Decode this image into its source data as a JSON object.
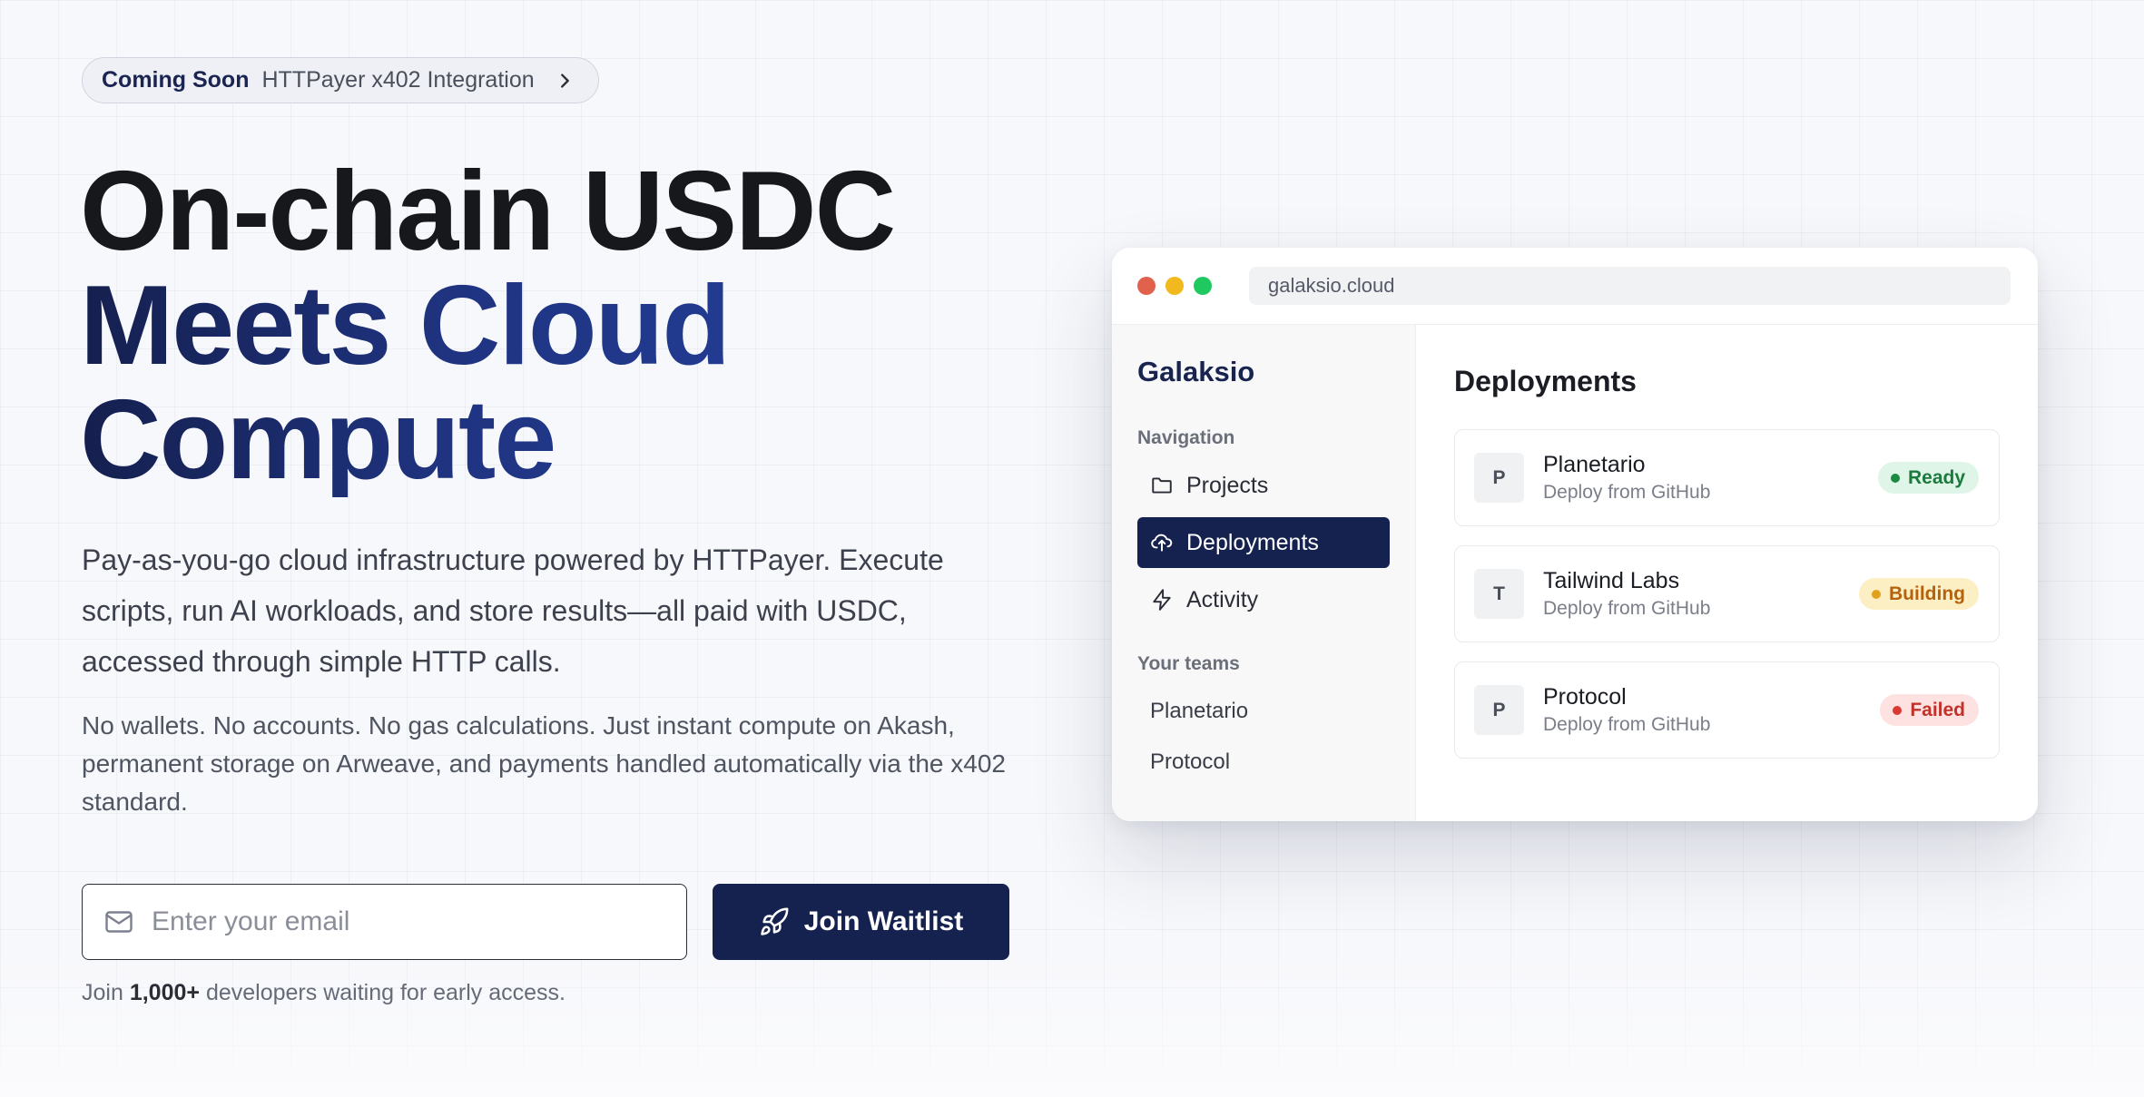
{
  "announcement": {
    "tag": "Coming Soon",
    "text": "HTTPayer x402 Integration",
    "icon": "chevron-right-icon"
  },
  "hero": {
    "line1": "On-chain USDC",
    "line2": "Meets Cloud",
    "line3": "Compute",
    "lead": "Pay-as-you-go cloud infrastructure powered by HTTPayer. Execute scripts, run AI workloads, and store results—all paid with USDC, accessed through simple HTTP calls.",
    "sub": "No wallets. No accounts. No gas calculations. Just instant compute on Akash, permanent storage on Arweave, and payments handled automatically via the x402 standard."
  },
  "form": {
    "email_placeholder": "Enter your email",
    "email_value": "",
    "email_icon": "mail-icon",
    "button_label": "Join Waitlist",
    "button_icon": "rocket-icon"
  },
  "social": {
    "prefix": "Join",
    "count": "1,000+",
    "suffix": "developers waiting for early access."
  },
  "browser": {
    "url": "galaksio.cloud",
    "traffic_colors": [
      "#e0614c",
      "#f1b91d",
      "#1fc95f"
    ],
    "brand": "Galaksio",
    "nav_heading": "Navigation",
    "nav": [
      {
        "label": "Projects",
        "icon": "folder-icon",
        "active": false
      },
      {
        "label": "Deployments",
        "icon": "cloud-upload-icon",
        "active": true
      },
      {
        "label": "Activity",
        "icon": "activity-icon",
        "active": false
      }
    ],
    "teams_heading": "Your teams",
    "teams": [
      "Planetario",
      "Protocol"
    ],
    "main_title": "Deployments",
    "deployments": [
      {
        "initial": "P",
        "name": "Planetario",
        "source": "Deploy from GitHub",
        "status": "Ready",
        "status_bg": "#dff5e7",
        "status_fg": "#1c7a3f",
        "status_dot": "#1c8a45"
      },
      {
        "initial": "T",
        "name": "Tailwind Labs",
        "source": "Deploy from GitHub",
        "status": "Building",
        "status_bg": "#fcefc4",
        "status_fg": "#b4620e",
        "status_dot": "#e0a11c"
      },
      {
        "initial": "P",
        "name": "Protocol",
        "source": "Deploy from GitHub",
        "status": "Failed",
        "status_bg": "#fde2e1",
        "status_fg": "#c0322a",
        "status_dot": "#d83a31"
      }
    ]
  },
  "colors": {
    "navy": "#15224f",
    "headline_dark": "#17181c",
    "headline_blue": "#1f3380"
  }
}
